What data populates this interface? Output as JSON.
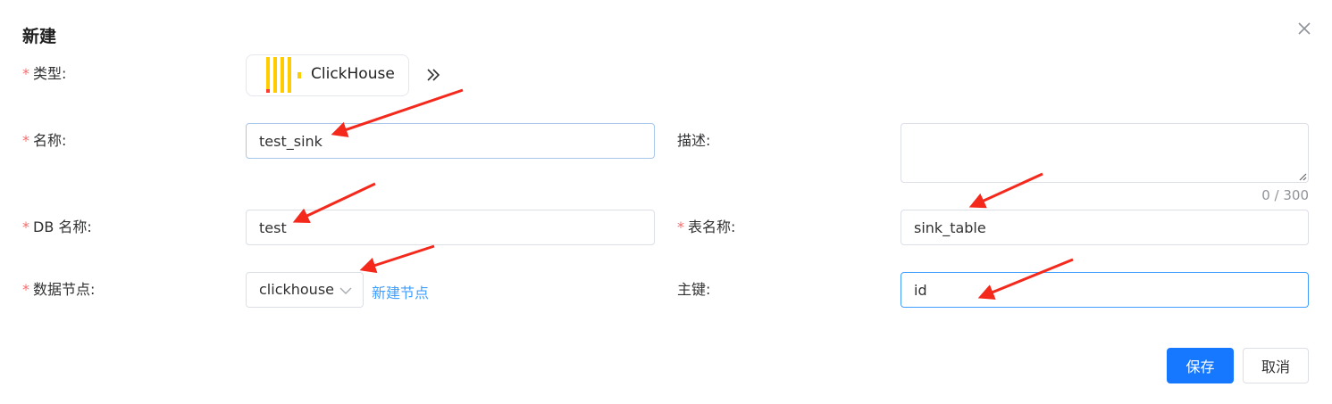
{
  "dialog": {
    "title": "新建"
  },
  "form": {
    "required_mark": "*",
    "type": {
      "label": "类型:",
      "value": "ClickHouse"
    },
    "name": {
      "label": "名称:",
      "value": "test_sink"
    },
    "description": {
      "label": "描述:",
      "value": "",
      "counter": "0 / 300"
    },
    "db_name": {
      "label": "DB 名称:",
      "value": "test"
    },
    "table_name": {
      "label": "表名称:",
      "value": "sink_table"
    },
    "data_node": {
      "label": "数据节点:",
      "value": "clickhouse",
      "create_link": "新建节点"
    },
    "primary_key": {
      "label": "主键:",
      "value": "id"
    }
  },
  "buttons": {
    "save": "保存",
    "cancel": "取消"
  },
  "colors": {
    "primary": "#1677ff",
    "link": "#409eff",
    "required": "#f56c6c",
    "annotation_arrow": "#f5281c",
    "clickhouse_yellow": "#ffcc00",
    "clickhouse_red": "#ff3b30"
  },
  "icons": {
    "close": "close-icon",
    "expand": "double-chevron-right-icon",
    "select": "chevron-down-icon",
    "brand": "clickhouse-logo-icon"
  }
}
